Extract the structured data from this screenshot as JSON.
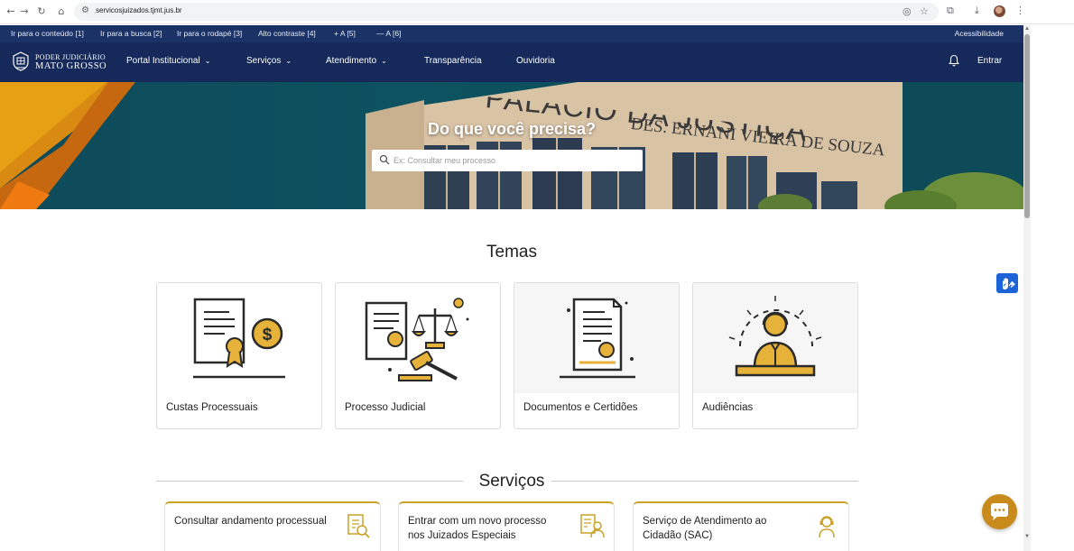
{
  "browser": {
    "url": "servicosjuizados.tjmt.jus.br",
    "icons": {
      "back": "back-arrow-icon",
      "forward": "forward-arrow-icon",
      "reload": "reload-icon",
      "home": "home-icon"
    }
  },
  "accessibility_bar": {
    "links": [
      "Ir para o conteúdo [1]",
      "Ir para a busca [2]",
      "Ir para o rodapé [3]",
      "Alto contraste [4]",
      "+ A [5]",
      "— A [6]"
    ],
    "right_label": "Acessibilidade"
  },
  "header": {
    "logo_line1": "Poder Judiciário",
    "logo_line2": "Mato Grosso",
    "nav": [
      {
        "label": "Portal Institucional",
        "dropdown": true
      },
      {
        "label": "Serviços",
        "dropdown": true
      },
      {
        "label": "Atendimento",
        "dropdown": true
      },
      {
        "label": "Transparência",
        "dropdown": false
      },
      {
        "label": "Ouvidoria",
        "dropdown": false
      }
    ],
    "login_label": "Entrar"
  },
  "hero": {
    "title": "Do que você precisa?",
    "search_placeholder": "Ex: Consultar meu processo",
    "building_line1": "PALÁCIO DA JUSTIÇA",
    "building_line2": "DES. ERNANI VIEIRA DE SOUZA"
  },
  "temas": {
    "title": "Temas",
    "cards": [
      {
        "label": "Custas Processuais",
        "icon": "certificate-dollar-icon"
      },
      {
        "label": "Processo Judicial",
        "icon": "scales-gavel-icon"
      },
      {
        "label": "Documentos e Certidões",
        "icon": "document-certificate-icon"
      },
      {
        "label": "Audiências",
        "icon": "hearing-attendant-icon"
      }
    ]
  },
  "servicos": {
    "title": "Serviços",
    "cards": [
      {
        "label": "Consultar andamento processual",
        "icon": "document-search-icon"
      },
      {
        "label": "Entrar com um novo processo nos Juizados Especiais",
        "icon": "document-person-icon"
      },
      {
        "label": "Serviço de Atendimento ao Cidadão (SAC)",
        "icon": "headset-person-icon"
      }
    ]
  },
  "colors": {
    "accessibility_bar": "#1a3266",
    "nav": "#15295a",
    "accent_gold": "#c9a227",
    "chat": "#c98a1c",
    "vlibras": "#1d63d8"
  }
}
